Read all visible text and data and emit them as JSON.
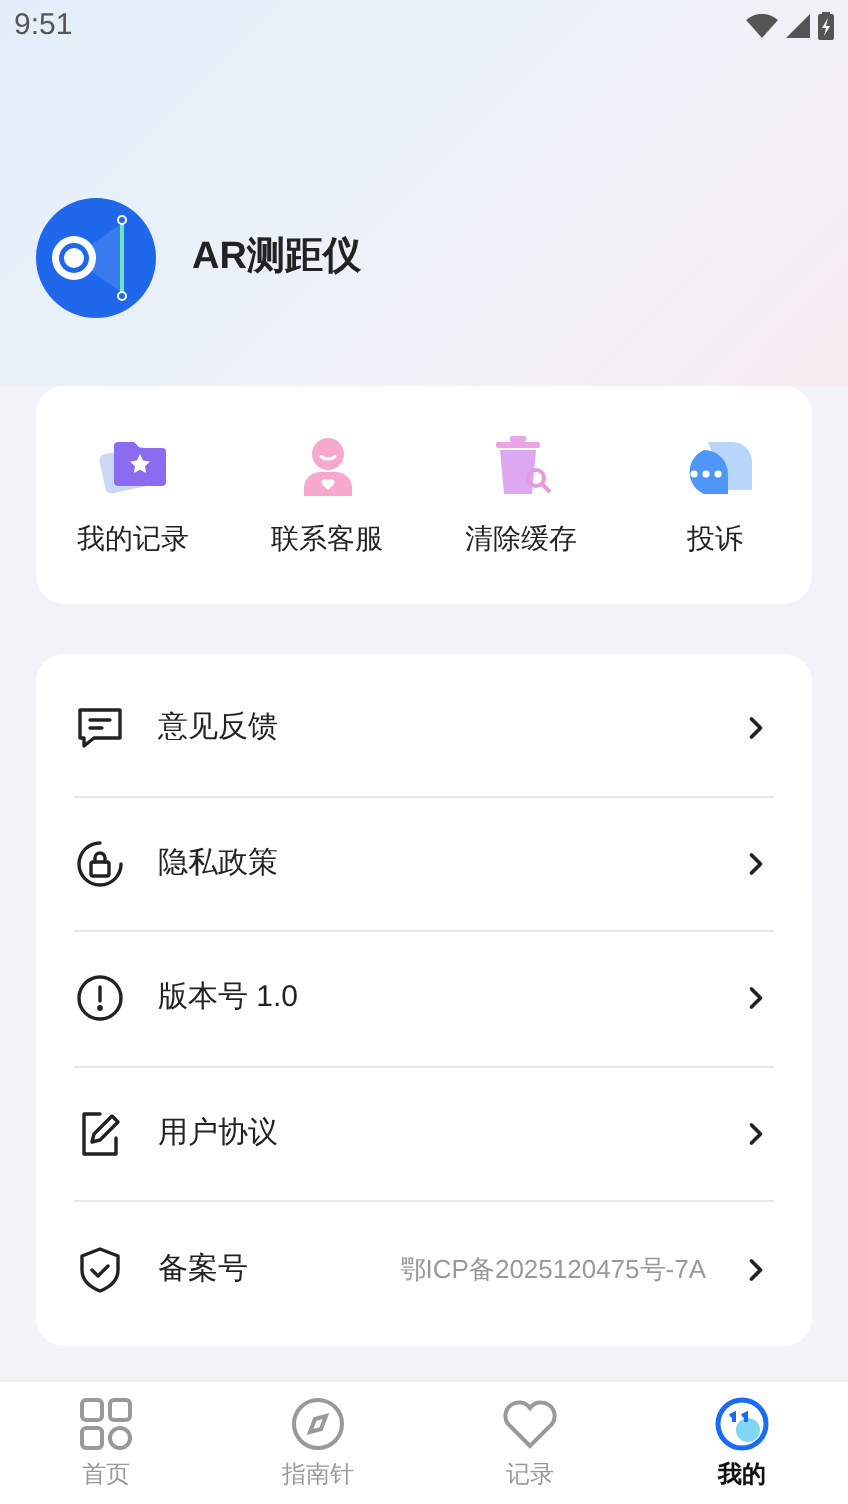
{
  "status_bar": {
    "time": "9:51"
  },
  "app": {
    "name": "AR测距仪"
  },
  "quick_actions": [
    {
      "kind": "records",
      "label": "我的记录"
    },
    {
      "kind": "service",
      "label": "联系客服"
    },
    {
      "kind": "clear",
      "label": "清除缓存"
    },
    {
      "kind": "complaint",
      "label": "投诉"
    }
  ],
  "menu": [
    {
      "kind": "feedback",
      "label": "意见反馈"
    },
    {
      "kind": "privacy",
      "label": "隐私政策"
    },
    {
      "kind": "version",
      "label": "版本号 1.0"
    },
    {
      "kind": "agreement",
      "label": "用户协议"
    },
    {
      "kind": "filing",
      "label": "备案号",
      "value": "鄂ICP备2025120475号-7A"
    }
  ],
  "tabs": [
    {
      "kind": "home",
      "label": "首页",
      "selected": false
    },
    {
      "kind": "compass",
      "label": "指南针",
      "selected": false
    },
    {
      "kind": "records",
      "label": "记录",
      "selected": false
    },
    {
      "kind": "mine",
      "label": "我的",
      "selected": true
    }
  ]
}
